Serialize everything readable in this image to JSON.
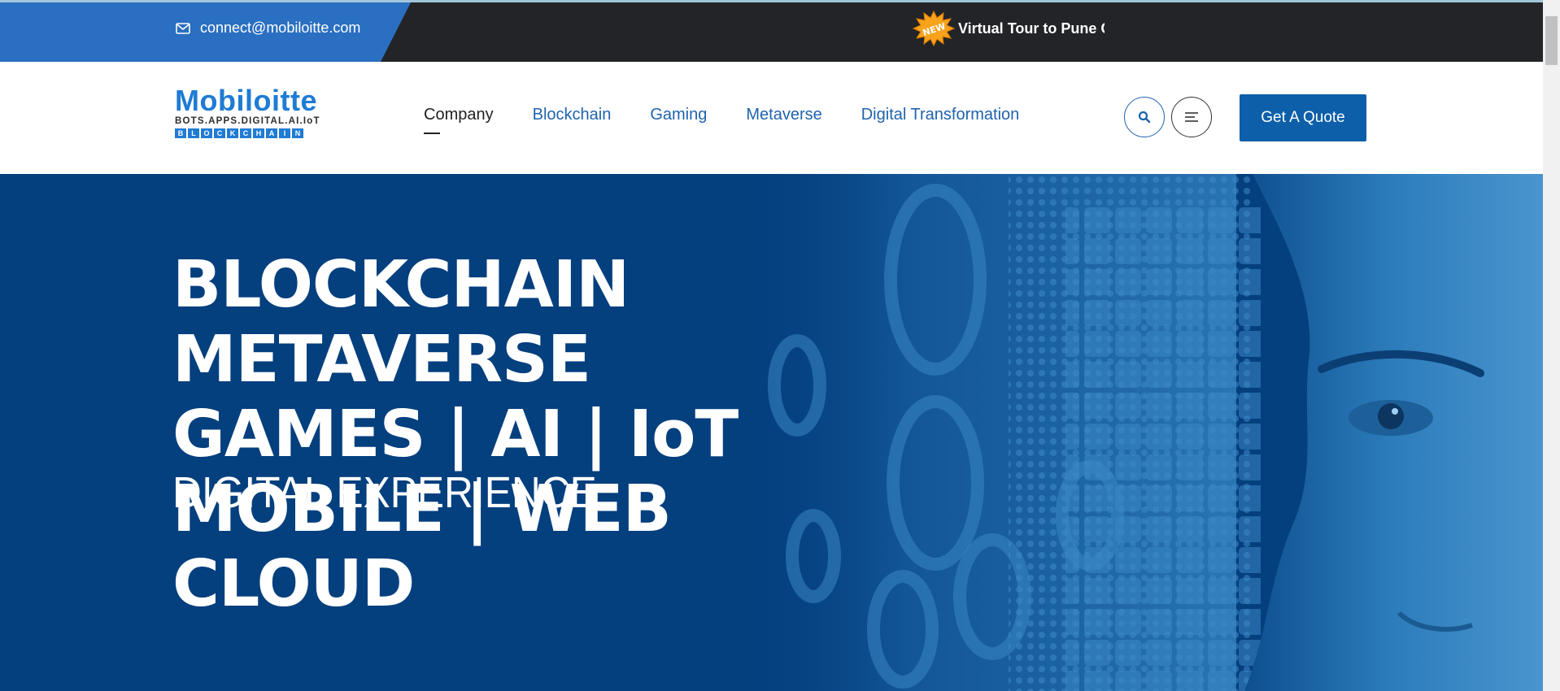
{
  "topbar": {
    "email": "connect@mobiloitte.com",
    "email_icon": "envelope-icon",
    "news_badge": "NEW",
    "news_text": "Virtual Tour to Pune Of"
  },
  "header": {
    "logo": {
      "name": "Mobiloitte",
      "tagline": "BOTS.APPS.DIGITAL.AI.IoT",
      "blockchain_letters": [
        "B",
        "L",
        "O",
        "C",
        "K",
        "C",
        "H",
        "A",
        "I",
        "N"
      ]
    },
    "nav": [
      {
        "label": "Company",
        "active": true
      },
      {
        "label": "Blockchain",
        "active": false
      },
      {
        "label": "Gaming",
        "active": false
      },
      {
        "label": "Metaverse",
        "active": false
      },
      {
        "label": "Digital Transformation",
        "active": false
      }
    ],
    "search_icon": "search-icon",
    "menu_icon": "menu-icon",
    "quote_label": "Get A Quote"
  },
  "hero": {
    "lines": [
      "BLOCKCHAIN",
      "METAVERSE",
      "GAMES | AI | IoT",
      "MOBILE | WEB",
      "CLOUD"
    ],
    "subtitle": "DIGITAL EXPERIENCE"
  },
  "colors": {
    "topbar_bg": "#232428",
    "email_block": "#2a6fc1",
    "brand_blue": "#1f7bd4",
    "nav_link": "#1f63ad",
    "quote_button": "#0c5fa8",
    "hero_bg": "#043f7e"
  }
}
